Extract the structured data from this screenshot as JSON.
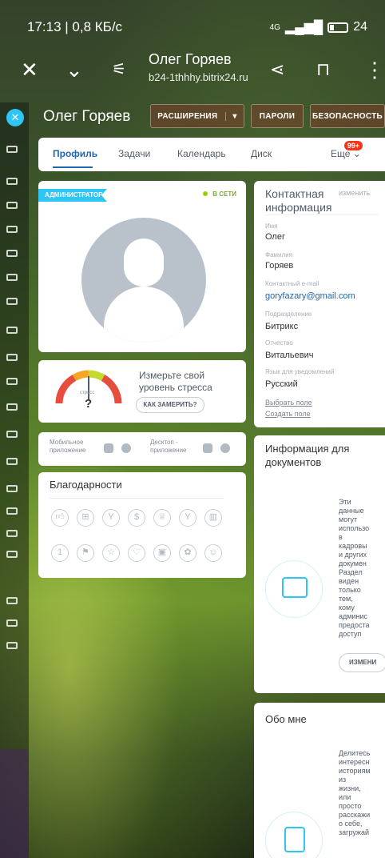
{
  "status_bar": {
    "time": "17:13 | 0,8 КБ/с",
    "network": "4G",
    "battery": "24"
  },
  "browser": {
    "title": "Олег Горяев",
    "url": "b24-1thhhy.bitrix24.ru"
  },
  "header": {
    "name": "Олег Горяев",
    "buttons": [
      "РАСШИРЕНИЯ",
      "ПАРОЛИ",
      "БЕЗОПАСНОСТЬ"
    ]
  },
  "tabs": {
    "items": [
      "Профиль",
      "Задачи",
      "Календарь",
      "Диск"
    ],
    "more_label": "Еще",
    "more_badge": "99+"
  },
  "profile_card": {
    "role_badge": "АДМИНИСТРАТОР",
    "status": "В СЕТИ"
  },
  "stress_card": {
    "gauge_label": "стресс",
    "gauge_value": "?",
    "text": "Измерьте свой уровень стресса",
    "button": "КАК ЗАМЕРИТЬ?"
  },
  "apps_card": {
    "mobile_label": "Мобильное приложение",
    "desktop_label": "Десктоп - приложение"
  },
  "thanks_card": {
    "title": "Благодарности"
  },
  "contact_card": {
    "title": "Контактная информация",
    "edit": "изменить",
    "fields": [
      {
        "label": "Имя",
        "value": "Олег"
      },
      {
        "label": "Фамилия",
        "value": "Горяев"
      },
      {
        "label": "Контактный e-mail",
        "value": "goryfazary@gmail.com"
      },
      {
        "label": "Подразделение",
        "value": "Битрикс"
      },
      {
        "label": "Отчество",
        "value": "Витальевич"
      },
      {
        "label": "Язык для уведомлений",
        "value": "Русский"
      }
    ],
    "select_field": "Выбрать поле",
    "create_field": "Создать поле"
  },
  "docs_card": {
    "title": "Информация для документов",
    "text": "Эти\nданные\nмогут\nиспользо\nв\nкадровы\nи других\nдокумен\nРаздел\nвиден\nтолько\nтем,\nкому\nадминис\nпредоста\nдоступ",
    "button": "ИЗМЕНИ"
  },
  "about_card": {
    "title": "Обо мне",
    "text": "Делитесь\nинтересн\nисториям\nиз\nжизни,\nили\nпросто\nрасскажи\nо себе,\nзагружай"
  },
  "colors": {
    "accent": "#2fc6f6",
    "link": "#2067b0",
    "online": "#9dcf00",
    "badge": "#f0371b"
  }
}
